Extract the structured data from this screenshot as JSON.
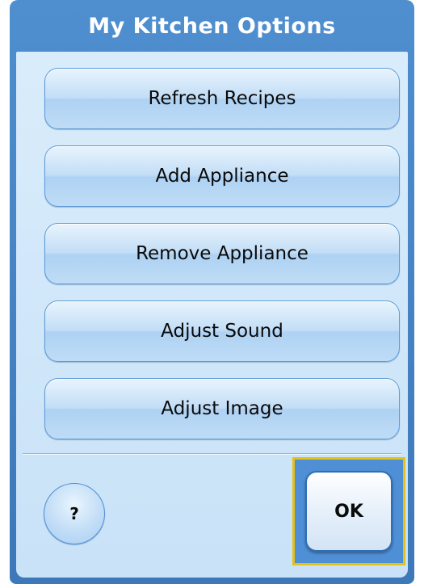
{
  "dialog": {
    "title": "My Kitchen Options"
  },
  "options": [
    {
      "label": "Refresh Recipes"
    },
    {
      "label": "Add Appliance"
    },
    {
      "label": "Remove Appliance"
    },
    {
      "label": "Adjust Sound"
    },
    {
      "label": "Adjust Image"
    }
  ],
  "footer": {
    "help_label": "?",
    "ok_label": "OK"
  },
  "colors": {
    "title_bar": "#3d78b9",
    "panel_background": "#d2e8fa",
    "focus_frame": "#e2c118"
  }
}
